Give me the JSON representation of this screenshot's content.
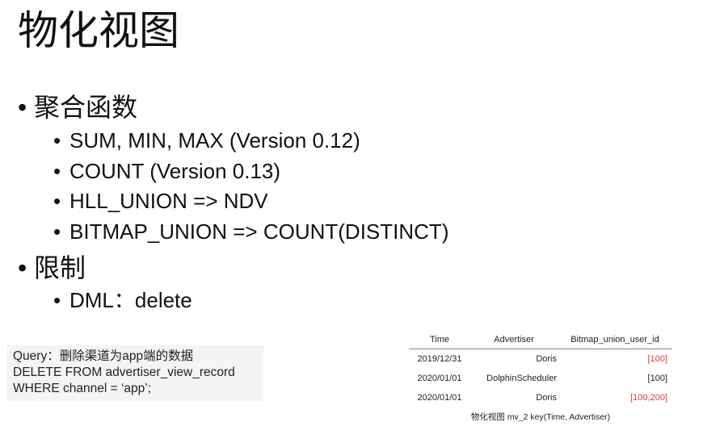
{
  "title": "物化视图",
  "bullets": [
    {
      "text": "聚合函数",
      "children": [
        "SUM, MIN, MAX (Version 0.12)",
        "COUNT (Version 0.13)",
        "HLL_UNION => NDV",
        "BITMAP_UNION => COUNT(DISTINCT)"
      ]
    },
    {
      "text": "限制",
      "children": [
        "DML：delete"
      ]
    }
  ],
  "code": [
    "Query：删除渠道为app端的数据",
    "DELETE FROM advertiser_view_record",
    "WHERE channel = ‘app’;"
  ],
  "table": {
    "headers": [
      "Time",
      "Advertiser",
      "Bitmap_union_user_id"
    ],
    "rows": [
      [
        "2019/12/31",
        "Doris",
        "[100]"
      ],
      [
        "2020/01/01",
        "DolphinScheduler",
        "[100]"
      ],
      [
        "2020/01/01",
        "Doris",
        "[100,200]"
      ]
    ],
    "highlight_color": "#e53935",
    "caption": "物化视图 mv_2 key(Time, Advertiser)"
  }
}
